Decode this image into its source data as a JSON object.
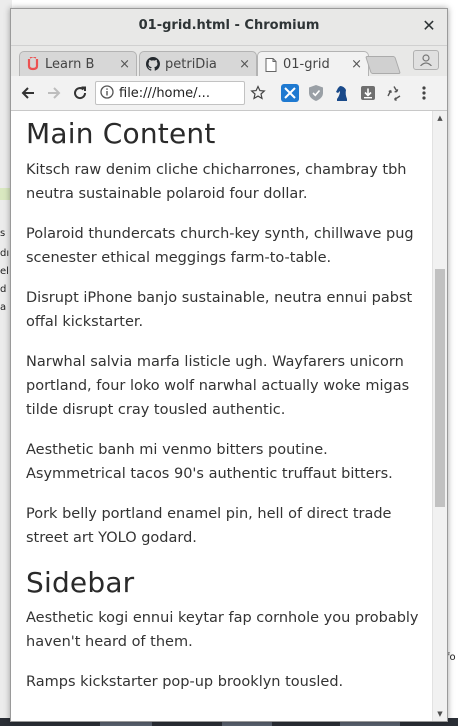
{
  "window": {
    "title": "01-grid.html - Chromium",
    "close_glyph": "✕"
  },
  "tabs": [
    {
      "label": "Learn B",
      "favicon": "udemy-icon",
      "active": false
    },
    {
      "label": "petriDia",
      "favicon": "github-icon",
      "active": false
    },
    {
      "label": "01-grid",
      "favicon": "document-icon",
      "active": true
    }
  ],
  "tab_close_glyph": "×",
  "toolbar": {
    "url": "file:///home/..."
  },
  "page": {
    "main_heading": "Main Content",
    "main_paragraphs": [
      "Kitsch raw denim cliche chicharrones, chambray tbh neutra sustainable polaroid four dollar.",
      "Polaroid thundercats church-key synth, chillwave pug scenester ethical meggings farm-to-table.",
      "Disrupt iPhone banjo sustainable, neutra ennui pabst offal kickstarter.",
      "Narwhal salvia marfa listicle ugh. Wayfarers unicorn portland, four loko wolf narwhal actually woke migas tilde disrupt cray tousled authentic.",
      "Aesthetic banh mi venmo bitters poutine. Asymmetrical tacos 90's authentic truffaut bitters.",
      "Pork belly portland enamel pin, hell of direct trade street art YOLO godard."
    ],
    "sidebar_heading": "Sidebar",
    "sidebar_paragraphs": [
      "Aesthetic kogi ennui keytar fap cornhole you probably haven't heard of them.",
      "Ramps kickstarter pop-up brooklyn tousled."
    ]
  },
  "desktop_fragments": {
    "left": [
      "s",
      "dı",
      "el",
      "d",
      "a"
    ],
    "right": [
      "fo"
    ]
  },
  "colors": {
    "udemy": "#ec5252",
    "github": "#24292e",
    "extension_blue": "#1f7ad1",
    "scroll_thumb": "#c1c1c1"
  }
}
